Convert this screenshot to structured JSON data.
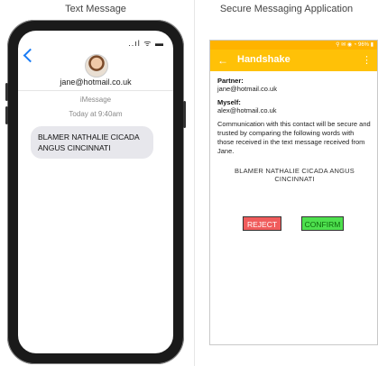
{
  "left_panel": {
    "title": "Text Message",
    "phone": {
      "status_icons": "..ıl ᯤ ▬",
      "contact_email": "jane@hotmail.co.uk",
      "service": "iMessage",
      "timestamp": "Today at 9:40am",
      "message": "BLAMER NATHALIE CICADA ANGUS CINCINNATI"
    }
  },
  "right_panel": {
    "title": "Secure Messaging Application",
    "app": {
      "status_bar": "⚲ ✉ ◉ ◔ 96% ▮",
      "header": {
        "back_icon": "arrow-left",
        "title": "Handshake",
        "menu_icon": "more-vertical"
      },
      "partner_label": "Partner:",
      "partner_value": "jane@hotmail.co.uk",
      "myself_label": "Myself:",
      "myself_value": "alex@hotmail.co.uk",
      "description": "Communication with this contact will be secure and trusted by comparing the following words with those received in the text message received from Jane.",
      "words": "BLAMER  NATHALIE  CICADA  ANGUS  CINCINNATI",
      "reject_label": "REJECT",
      "confirm_label": "CONFIRM"
    }
  },
  "colors": {
    "app_bar": "#ffc107",
    "reject": "#f05c5c",
    "confirm": "#4ee04e",
    "link_blue": "#1a7cf5"
  }
}
